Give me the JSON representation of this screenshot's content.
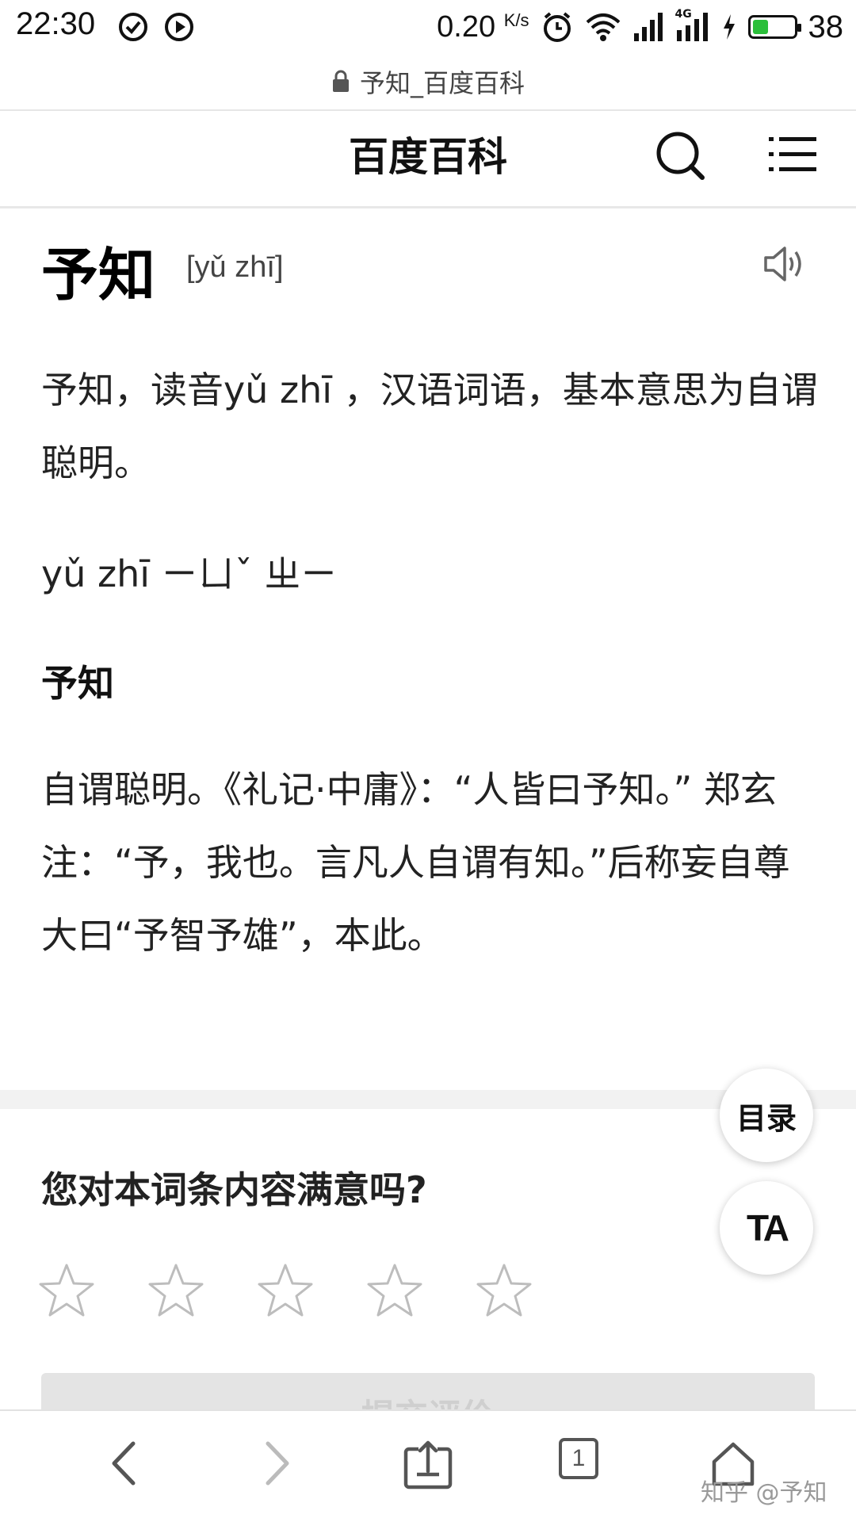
{
  "status_bar": {
    "time": "22:30",
    "net_speed": "0.20",
    "net_speed_unit": "K/s",
    "network_type": "4G",
    "battery_level": "38",
    "battery_color": "#2bbf3a",
    "icons": [
      "check-circle-icon",
      "play-circle-icon",
      "alarm-icon",
      "wifi-icon",
      "signal-icon",
      "signal-4g-icon",
      "charging-icon",
      "battery-icon"
    ]
  },
  "url_bar": {
    "lock_icon": "lock-icon",
    "url": "予知_百度百科"
  },
  "header": {
    "title": "百度百科",
    "search_icon": "search-icon",
    "menu_icon": "menu-icon"
  },
  "entry": {
    "title": "予知",
    "pinyin": "[yǔ zhī]",
    "speaker_icon": "speaker-icon",
    "summary": "予知，读音yǔ zhī ，汉语词语，基本意思为自谓聪明。",
    "pinyin_line": "yǔ zhī ㄧㄩˇ ㄓㄧ",
    "sub_heading": "予知",
    "definition": "自谓聪明。《礼记·中庸》：“人皆曰予知。” 郑玄 注：“予，我也。言凡人自谓有知。”后称妄自尊大曰“予智予雄”，本此。"
  },
  "rating": {
    "question": "您对本词条内容满意吗?",
    "stars": 5,
    "stars_selected": 0,
    "submit_label": "提交评价"
  },
  "floating": {
    "toc_label": "目录",
    "ta_label": "TA"
  },
  "bottom_bar": {
    "tab_count": "1",
    "icons": [
      "back-icon",
      "forward-icon",
      "share-icon",
      "tabs-icon",
      "home-icon"
    ]
  },
  "watermark": "知乎 @予知"
}
